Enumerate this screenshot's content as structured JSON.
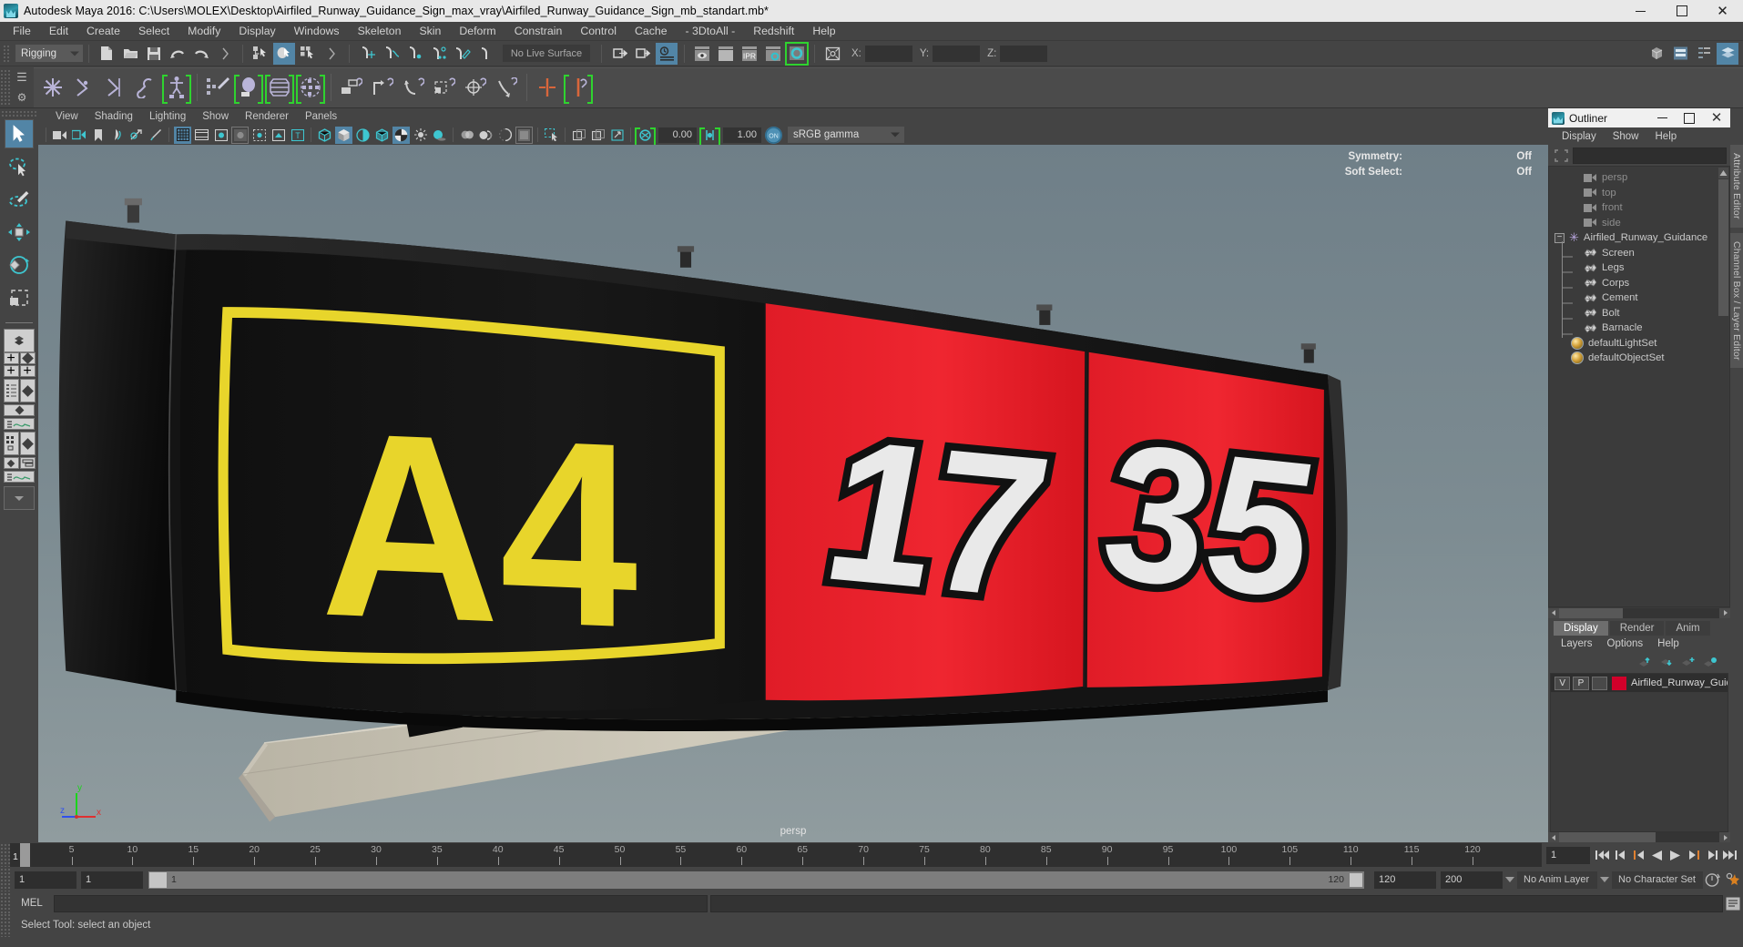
{
  "window": {
    "title": "Autodesk Maya 2016: C:\\Users\\MOLEX\\Desktop\\Airfiled_Runway_Guidance_Sign_max_vray\\Airfiled_Runway_Guidance_Sign_mb_standart.mb*",
    "app_icon": "maya-logo-icon",
    "minimize": "minimize-icon",
    "maximize": "maximize-icon",
    "close": "close-icon"
  },
  "menubar": {
    "items": [
      "File",
      "Edit",
      "Create",
      "Select",
      "Modify",
      "Display",
      "Windows",
      "Skeleton",
      "Skin",
      "Deform",
      "Constrain",
      "Control",
      "Cache",
      "- 3DtoAll -",
      "Redshift",
      "Help"
    ]
  },
  "statusline": {
    "menu_set": "Rigging",
    "live_surface": "No Live Surface",
    "x_label": "X:",
    "y_label": "Y:",
    "z_label": "Z:",
    "x_value": "",
    "y_value": "",
    "z_value": "",
    "ipr_label": "IPR"
  },
  "viewport_menu": {
    "items": [
      "View",
      "Shading",
      "Lighting",
      "Show",
      "Renderer",
      "Panels"
    ]
  },
  "viewport_toolbar": {
    "exposure_value": "0.00",
    "gamma_value": "1.00",
    "color_space": "sRGB gamma",
    "color_management_toggle": "ON"
  },
  "viewport": {
    "camera_label": "persp",
    "hud": [
      {
        "label": "Symmetry:",
        "value": "Off"
      },
      {
        "label": "Soft Select:",
        "value": "Off"
      }
    ],
    "axis": {
      "x": "x",
      "y": "y",
      "z": "z"
    },
    "model": {
      "sign_panel_1_text": "A4",
      "sign_panel_2_text": "17",
      "sign_panel_3_text": "35",
      "panel_1_bg": "#111111",
      "panel_1_fg": "#e8d52b",
      "panel_2_bg": "#e8202c",
      "panel_3_bg": "#e8202c",
      "digit_fill": "#e6e6e6",
      "base_color": "#c8c3b4",
      "leg_color": "#181818",
      "bg_top": "#72828a",
      "bg_bottom": "#8d9a9e"
    }
  },
  "outliner": {
    "title": "Outliner",
    "minimize": "minimize-icon",
    "maximize": "maximize-icon",
    "close": "close-icon",
    "menu": [
      "Display",
      "Show",
      "Help"
    ],
    "search_value": "",
    "items": [
      {
        "label": "persp",
        "icon": "camera-icon",
        "depth": 0,
        "dim": true
      },
      {
        "label": "top",
        "icon": "camera-icon",
        "depth": 0,
        "dim": true
      },
      {
        "label": "front",
        "icon": "camera-icon",
        "depth": 0,
        "dim": true
      },
      {
        "label": "side",
        "icon": "camera-icon",
        "depth": 0,
        "dim": true
      },
      {
        "label": "Airfiled_Runway_Guidance",
        "icon": "group-star-icon",
        "depth": 0,
        "dim": false,
        "expanded": true
      },
      {
        "label": "Screen",
        "icon": "mesh-icon",
        "depth": 1,
        "dim": false
      },
      {
        "label": "Legs",
        "icon": "mesh-icon",
        "depth": 1,
        "dim": false
      },
      {
        "label": "Corps",
        "icon": "mesh-icon",
        "depth": 1,
        "dim": false
      },
      {
        "label": "Cement",
        "icon": "mesh-icon",
        "depth": 1,
        "dim": false
      },
      {
        "label": "Bolt",
        "icon": "mesh-icon",
        "depth": 1,
        "dim": false
      },
      {
        "label": "Barnacle",
        "icon": "mesh-icon",
        "depth": 1,
        "dim": false
      },
      {
        "label": "defaultLightSet",
        "icon": "set-icon",
        "depth": 0,
        "dim": false
      },
      {
        "label": "defaultObjectSet",
        "icon": "set-icon",
        "depth": 0,
        "dim": false
      }
    ]
  },
  "layer_editor": {
    "tabs": [
      "Display",
      "Render",
      "Anim"
    ],
    "active_tab": "Display",
    "menu": [
      "Layers",
      "Options",
      "Help"
    ],
    "layers": [
      {
        "visibility": "V",
        "playback": "P",
        "extra": "",
        "color": "#d1002a",
        "name": "Airfiled_Runway_Guid"
      }
    ]
  },
  "side_tabs": [
    "Attribute Editor",
    "Channel Box / Layer Editor"
  ],
  "timeline": {
    "start": 1,
    "end": 120,
    "current_frame": "1",
    "ticks": [
      5,
      10,
      15,
      20,
      25,
      30,
      35,
      40,
      45,
      50,
      55,
      60,
      65,
      70,
      75,
      80,
      85,
      90,
      95,
      100,
      105,
      110,
      115,
      120
    ],
    "cursor_label": "1"
  },
  "range": {
    "anim_start": "1",
    "anim_end": "1",
    "range_bar_start_label": "1",
    "range_bar_end_label": "120",
    "playback_end": "120",
    "anim_end_total": "200",
    "anim_layer": "No Anim Layer",
    "character_set": "No Character Set"
  },
  "command_line": {
    "language_label": "MEL",
    "input_value": "",
    "output_value": ""
  },
  "help_line": {
    "text": "Select Tool: select an object"
  }
}
